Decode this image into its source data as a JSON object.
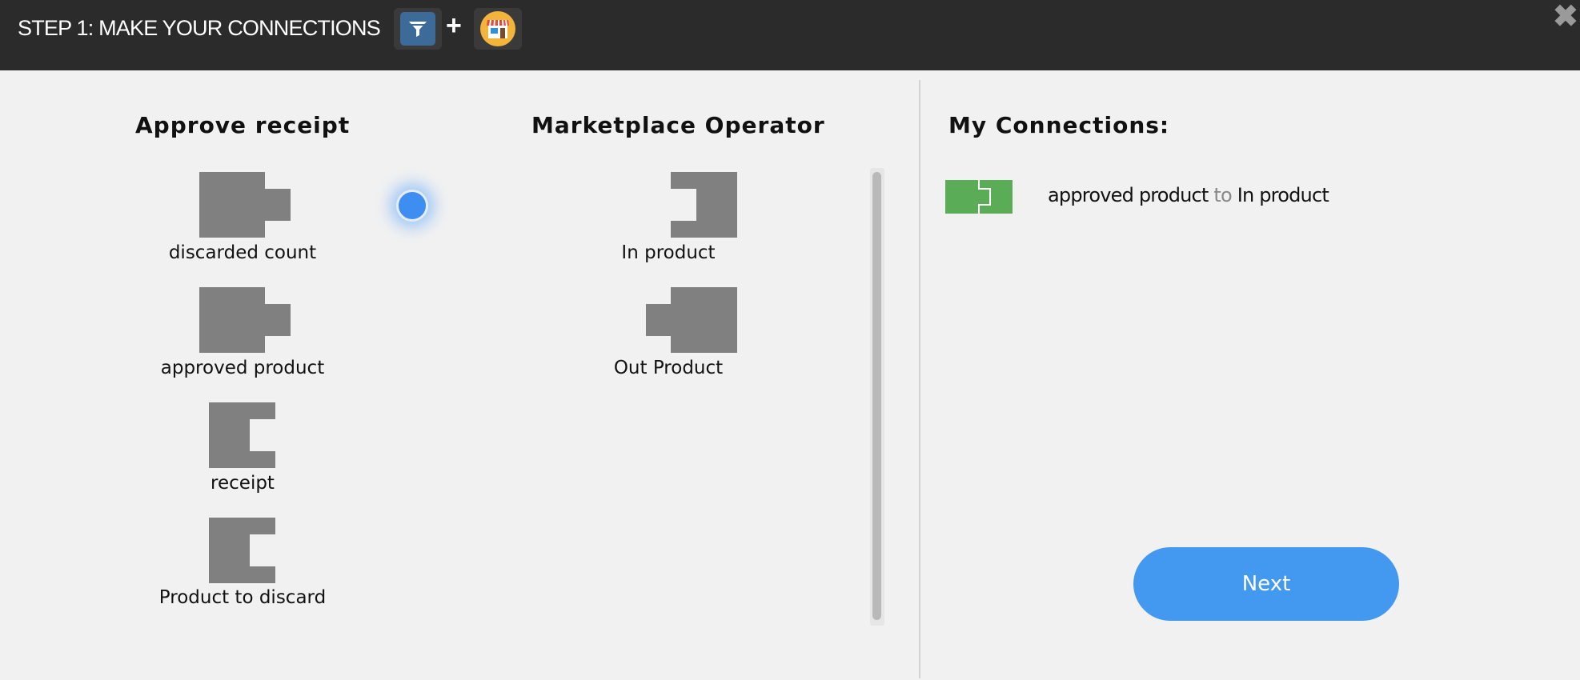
{
  "header": {
    "title": "STEP 1: MAKE YOUR CONNECTIONS",
    "plus": "+",
    "close": "✖",
    "app_icons": [
      "filter-icon",
      "marketplace-store-icon"
    ]
  },
  "left_panel": {
    "heading": "Approve receipt",
    "ports": [
      {
        "label": "discarded count",
        "direction": "output"
      },
      {
        "label": "approved product",
        "direction": "output"
      },
      {
        "label": "receipt",
        "direction": "input"
      },
      {
        "label": "Product to discard",
        "direction": "input"
      }
    ]
  },
  "middle_panel": {
    "heading": "Marketplace Operator",
    "ports": [
      {
        "label": "In product",
        "direction": "input"
      },
      {
        "label": "Out Product",
        "direction": "output"
      }
    ]
  },
  "connections_panel": {
    "heading": "My Connections:",
    "connections": [
      {
        "from": "approved product",
        "joiner": "to",
        "to": "In product"
      }
    ]
  },
  "actions": {
    "next_label": "Next"
  },
  "colors": {
    "header_bg": "#2b2b2b",
    "port_gray": "#808080",
    "connection_green": "#5aac57",
    "button_blue": "#4299ef"
  }
}
